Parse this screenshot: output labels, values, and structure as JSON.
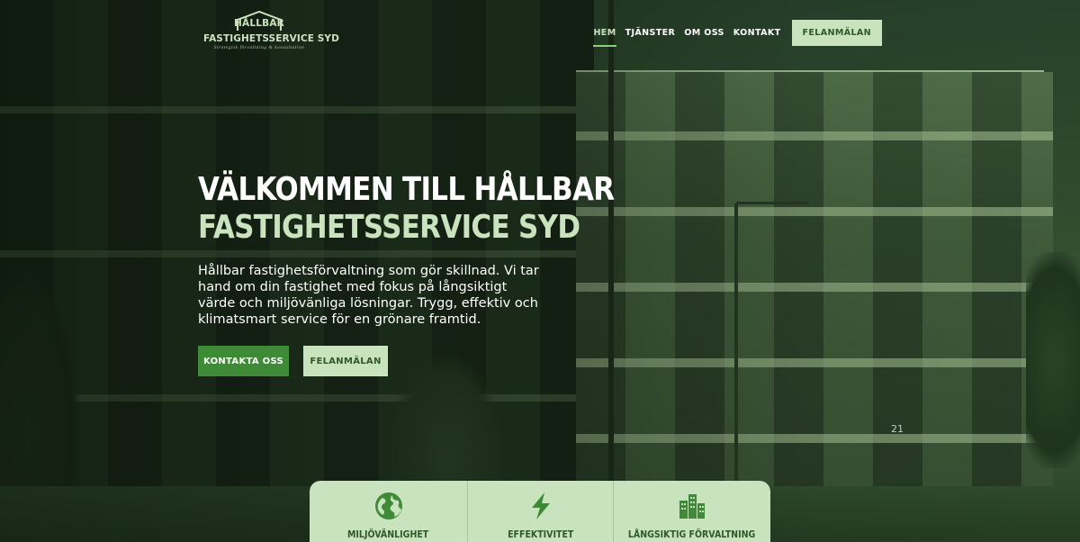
{
  "brand": {
    "name": "HÅLLBAR",
    "subtitle": "FASTIGHETSSERVICE SYD",
    "tagline": "Strategisk förvaltning & konsultation"
  },
  "nav": {
    "items": [
      {
        "label": "HEM",
        "active": true
      },
      {
        "label": "TJÄNSTER",
        "active": false
      },
      {
        "label": "OM OSS",
        "active": false
      },
      {
        "label": "KONTAKT",
        "active": false
      }
    ],
    "cta_label": "FELANMÄLAN"
  },
  "hero": {
    "title_line1": "VÄLKOMMEN TILL HÅLLBAR",
    "title_line2": "FASTIGHETSSERVICE SYD",
    "description": "Hållbar fastighetsförvaltning som gör skillnad. Vi tar hand om din fastighet med fokus på långsiktigt värde och miljövänliga lösningar. Trygg, effektiv och klimatsmart service för en grönare framtid.",
    "primary_button": "KONTAKTA OSS",
    "secondary_button": "FELANMÄLAN",
    "building_number": "21"
  },
  "features": [
    {
      "label": "MILJÖVÄNLIGHET",
      "icon": "globe-icon"
    },
    {
      "label": "EFFEKTIVITET",
      "icon": "lightning-icon"
    },
    {
      "label": "LÅNGSIKTIG FÖRVALTNING",
      "icon": "city-icon"
    }
  ],
  "colors": {
    "accent_light": "#c8e3bd",
    "accent_dark": "#2e5a2b",
    "button_green": "#3f8a36",
    "icon_green": "#3f8a36"
  }
}
